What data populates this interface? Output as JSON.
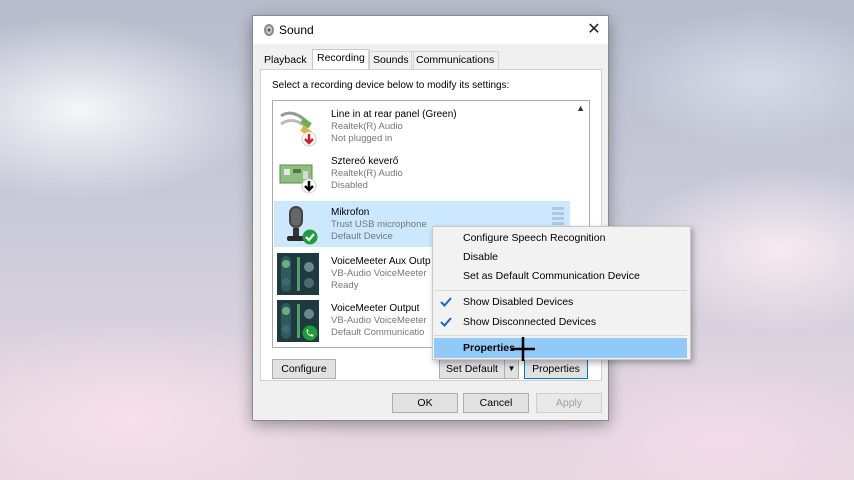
{
  "window": {
    "title": "Sound",
    "close_label": "✕"
  },
  "tabs": [
    {
      "label": "Playback",
      "active": false
    },
    {
      "label": "Recording",
      "active": true
    },
    {
      "label": "Sounds",
      "active": false
    },
    {
      "label": "Communications",
      "active": false
    }
  ],
  "instruction": "Select a recording device below to modify its settings:",
  "devices": [
    {
      "name": "Line in at rear panel (Green)",
      "driver": "Realtek(R) Audio",
      "status": "Not plugged in",
      "icon": "line-in-icon",
      "badge": "red-down-arrow"
    },
    {
      "name": "Sztereó keverő",
      "driver": "Realtek(R) Audio",
      "status": "Disabled",
      "icon": "stereo-mix-icon",
      "badge": "black-down-arrow"
    },
    {
      "name": "Mikrofon",
      "driver": "Trust USB microphone",
      "status": "Default Device",
      "icon": "microphone-icon",
      "badge": "green-check",
      "selected": true
    },
    {
      "name": "VoiceMeeter Aux Outp",
      "driver": "VB-Audio VoiceMeeter",
      "status": "Ready",
      "icon": "voicemeeter-icon",
      "badge": "none"
    },
    {
      "name": "VoiceMeeter Output",
      "driver": "VB-Audio VoiceMeeter",
      "status": "Default Communicatio",
      "icon": "voicemeeter-icon",
      "badge": "green-phone"
    }
  ],
  "buttons": {
    "configure": "Configure",
    "set_default": "Set Default",
    "properties": "Properties",
    "ok": "OK",
    "cancel": "Cancel",
    "apply": "Apply"
  },
  "context_menu": {
    "items": [
      {
        "label": "Configure Speech Recognition",
        "checked": false
      },
      {
        "label": "Disable",
        "checked": false
      },
      {
        "label": "Set as Default Communication Device",
        "checked": false
      },
      {
        "label": "Show Disabled Devices",
        "checked": true
      },
      {
        "label": "Show Disconnected Devices",
        "checked": true
      },
      {
        "label": "Properties",
        "checked": false,
        "highlighted": true
      }
    ]
  },
  "colors": {
    "selection": "#cce8ff",
    "menu_highlight": "#91c9f7",
    "check_blue": "#1a66cc",
    "badge_green": "#1e9e3a",
    "badge_red": "#d32020"
  }
}
